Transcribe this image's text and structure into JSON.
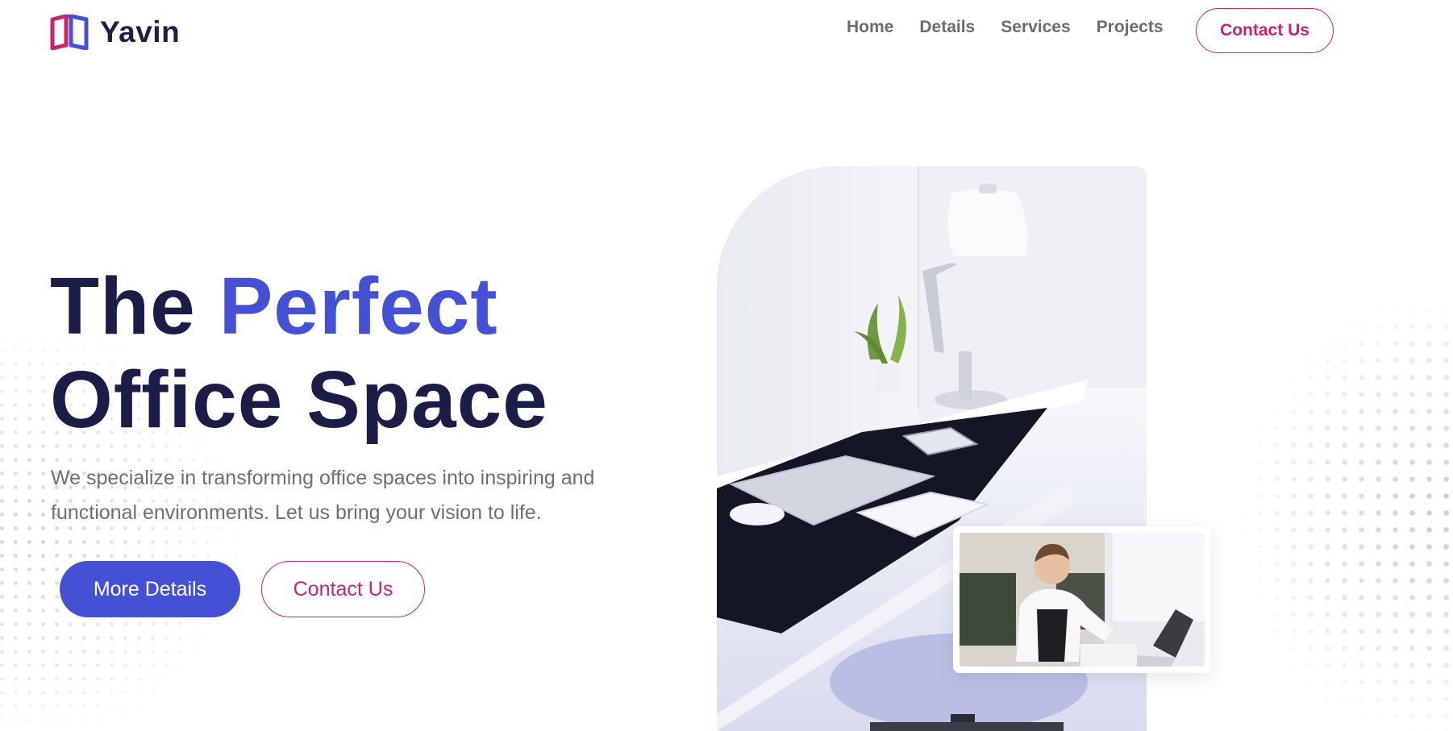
{
  "brand": {
    "name": "Yavin",
    "logo_icon": "open-book-icon"
  },
  "nav": {
    "items": [
      "Home",
      "Details",
      "Services",
      "Projects"
    ],
    "contact_label": "Contact Us"
  },
  "hero": {
    "title_part1": "The ",
    "title_accent": "Perfect",
    "title_line2": "Office Space",
    "subtitle_line1": "We specialize in transforming office spaces into inspiring and",
    "subtitle_line2": "functional environments. Let us bring your vision to life.",
    "primary_button": "More Details",
    "secondary_button": "Contact Us"
  },
  "images": {
    "main": "office-desk-photo",
    "inset": "woman-working-photo"
  },
  "colors": {
    "brand_dark": "#1a1d48",
    "accent_blue": "#4451d4",
    "accent_pink": "#c8256a",
    "text_gray": "#6e6e75"
  }
}
